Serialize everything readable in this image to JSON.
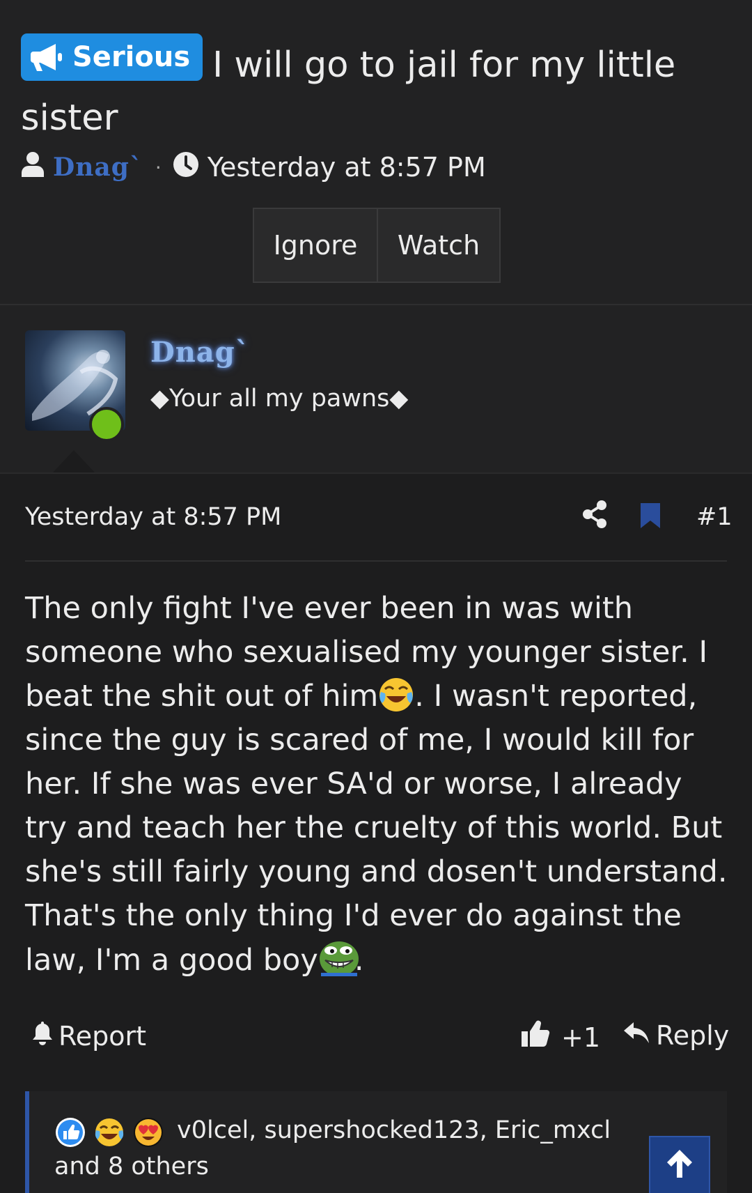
{
  "thread": {
    "prefix_label": "Serious",
    "prefix_icon": "megaphone-icon",
    "title": "I will go to jail for my little sister",
    "author": "Dnag`",
    "timestamp": "Yesterday at 8:57 PM",
    "separator": "·"
  },
  "actions": {
    "ignore_label": "Ignore",
    "watch_label": "Watch"
  },
  "post": {
    "user_name": "Dnag`",
    "user_title": "◆Your all my pawns◆",
    "online": true,
    "date": "Yesterday at 8:57 PM",
    "number": "#1",
    "body_part1": "The only fight I've ever been in was with someone who sexualised my younger sister. I beat the shit out of him",
    "emoji1": "crying-laughing-emoji",
    "body_part2": ". I wasn't reported, since the guy is scared of me, I would kill for her. If she was ever SA'd or worse, I already try and teach her the cruelty of this world. But she's still fairly young and dosen't understand. That's the only thing I'd ever do against the law, I'm a good boy",
    "emoji2": "pepe-grin-emoji",
    "body_part3": ".",
    "report_label": "Report",
    "like_label": "+1",
    "reply_label": "Reply"
  },
  "reactions": {
    "icons": [
      "like-reaction-icon",
      "haha-reaction-icon",
      "love-reaction-icon"
    ],
    "text": "v0lcel, supershocked123, Eric_mxcl and 8 others"
  },
  "colors": {
    "background": "#222223",
    "accent_blue": "#1f8de0",
    "author_blue": "#3e6ec4",
    "online_green": "#6fbf1a"
  }
}
